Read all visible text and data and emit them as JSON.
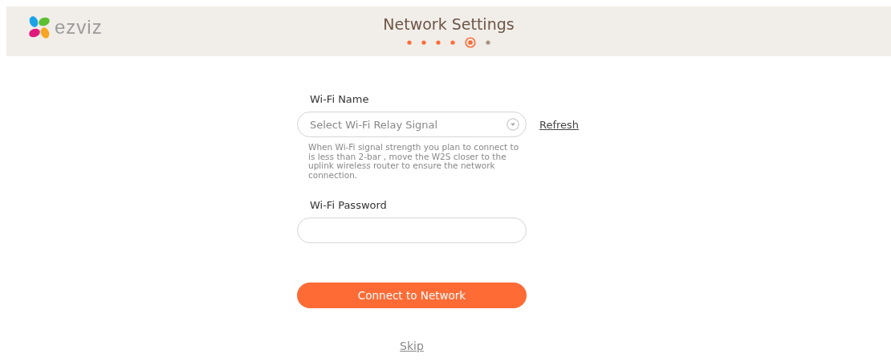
{
  "header": {
    "logo": {
      "text": "ezviz"
    },
    "title": "Network Settings",
    "steps": [
      {
        "completed": true,
        "selected": false
      },
      {
        "completed": true,
        "selected": false
      },
      {
        "completed": true,
        "selected": false
      },
      {
        "completed": true,
        "selected": false
      },
      {
        "completed": false,
        "selected": true
      },
      {
        "completed": false,
        "selected": false
      }
    ]
  },
  "form": {
    "wifi_name": {
      "label": "Wi-Fi Name",
      "placeholder": "Select Wi-Fi Relay Signal",
      "refresh": "Refresh",
      "hint": "When Wi-Fi signal strength you plan to connect to is less than 2-bar , move the W2S closer to the uplink wireless router to ensure the network connection."
    },
    "wifi_password": {
      "label": "Wi-Fi Password"
    },
    "connect_button": "Connect to Network",
    "skip": "Skip"
  }
}
